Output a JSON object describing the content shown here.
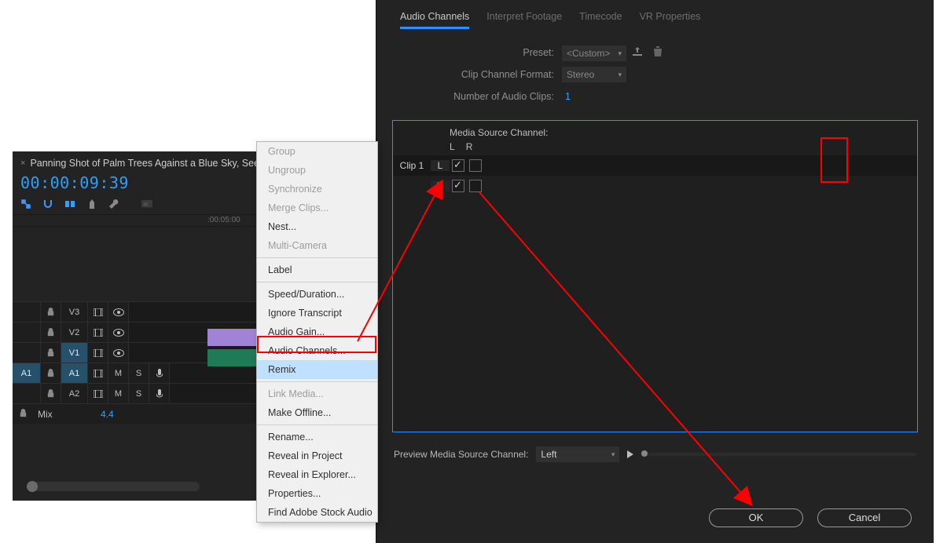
{
  "timeline": {
    "title": "Panning Shot of Palm Trees Against a Blue Sky, Seen",
    "timecode": "00:00:09:39",
    "ruler_ticks": [
      ":00:05:00"
    ],
    "tracks": {
      "v3": "V3",
      "v2": "V2",
      "v1": "V1",
      "a1_src": "A1",
      "a1": "A1",
      "a2": "A2",
      "m_label": "M",
      "s_label": "S"
    },
    "mix": {
      "label": "Mix",
      "value": "4.4"
    }
  },
  "context_menu": {
    "items": [
      {
        "label": "Group",
        "enabled": false
      },
      {
        "label": "Ungroup",
        "enabled": false
      },
      {
        "label": "Synchronize",
        "enabled": false
      },
      {
        "label": "Merge Clips...",
        "enabled": false
      },
      {
        "label": "Nest...",
        "enabled": true
      },
      {
        "label": "Multi-Camera",
        "enabled": false
      },
      {
        "sep": true
      },
      {
        "label": "Label",
        "enabled": true
      },
      {
        "sep": true
      },
      {
        "label": "Speed/Duration...",
        "enabled": true
      },
      {
        "label": "Ignore Transcript",
        "enabled": true
      },
      {
        "label": "Audio Gain...",
        "enabled": true
      },
      {
        "label": "Audio Channels...",
        "enabled": true,
        "highlight_box": true
      },
      {
        "label": "Remix",
        "enabled": true,
        "hl": true
      },
      {
        "sep": true
      },
      {
        "label": "Link Media...",
        "enabled": false
      },
      {
        "label": "Make Offline...",
        "enabled": true
      },
      {
        "sep": true
      },
      {
        "label": "Rename...",
        "enabled": true
      },
      {
        "label": "Reveal in Project",
        "enabled": true
      },
      {
        "label": "Reveal in Explorer...",
        "enabled": true
      },
      {
        "label": "Properties...",
        "enabled": true
      },
      {
        "label": "Find Adobe Stock Audio",
        "enabled": true
      }
    ]
  },
  "dialog": {
    "tabs": [
      "Audio Channels",
      "Interpret Footage",
      "Timecode",
      "VR Properties"
    ],
    "active_tab": 0,
    "preset_label": "Preset:",
    "preset_value": "<Custom>",
    "fmt_label": "Clip Channel Format:",
    "fmt_value": "Stereo",
    "num_label": "Number of Audio Clips:",
    "num_value": "1",
    "grid_header": "Media Source Channel:",
    "l": "L",
    "r": "R",
    "clip1": "Clip 1",
    "preview_label": "Preview Media Source Channel:",
    "preview_value": "Left",
    "ok": "OK",
    "cancel": "Cancel"
  }
}
